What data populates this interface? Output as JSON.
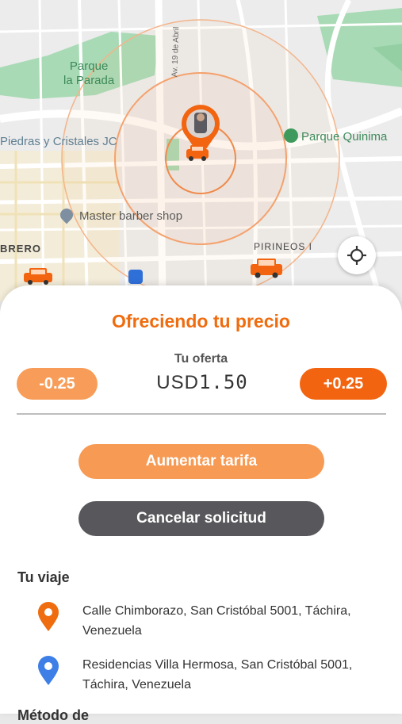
{
  "map": {
    "labels": {
      "park_parada": "Parque\nla Parada",
      "park_quinimari": "Parque Quinima",
      "piedras": "Piedras y Cristales JC",
      "barber": "Master barber shop",
      "brero": "BRERO",
      "pirineos": "PIRINEOS I",
      "avenue": "Av. 19 de Abril"
    },
    "colors": {
      "park": "#a8dab5",
      "road": "#ffffff",
      "pulse": "#f4a26e",
      "car": "#f26410"
    }
  },
  "sheet": {
    "title": "Ofreciendo tu precio",
    "offer_caption": "Tu oferta",
    "decrement_label": "-0.25",
    "increment_label": "+0.25",
    "currency": "USD",
    "amount": "1.50",
    "raise_fare_label": "Aumentar tarifa",
    "cancel_label": "Cancelar solicitud",
    "trip_section_title": "Tu viaje",
    "origin_address": "Calle Chimborazo, San Cristóbal 5001, Táchira, Venezuela",
    "destination_address": "Residencias Villa Hermosa, San Cristóbal 5001, Táchira, Venezuela",
    "next_section_title_partial": "Método de"
  },
  "colors": {
    "accent": "#f26410",
    "accent_light": "#f79d59",
    "dark_button": "#58585c",
    "origin_pin": "#ef6c0f",
    "destination_pin": "#3d7fe6"
  },
  "icons": [
    "crosshair-icon",
    "car-icon",
    "origin-pin-icon",
    "destination-pin-icon",
    "park-icon",
    "place-icon",
    "bus-icon"
  ]
}
